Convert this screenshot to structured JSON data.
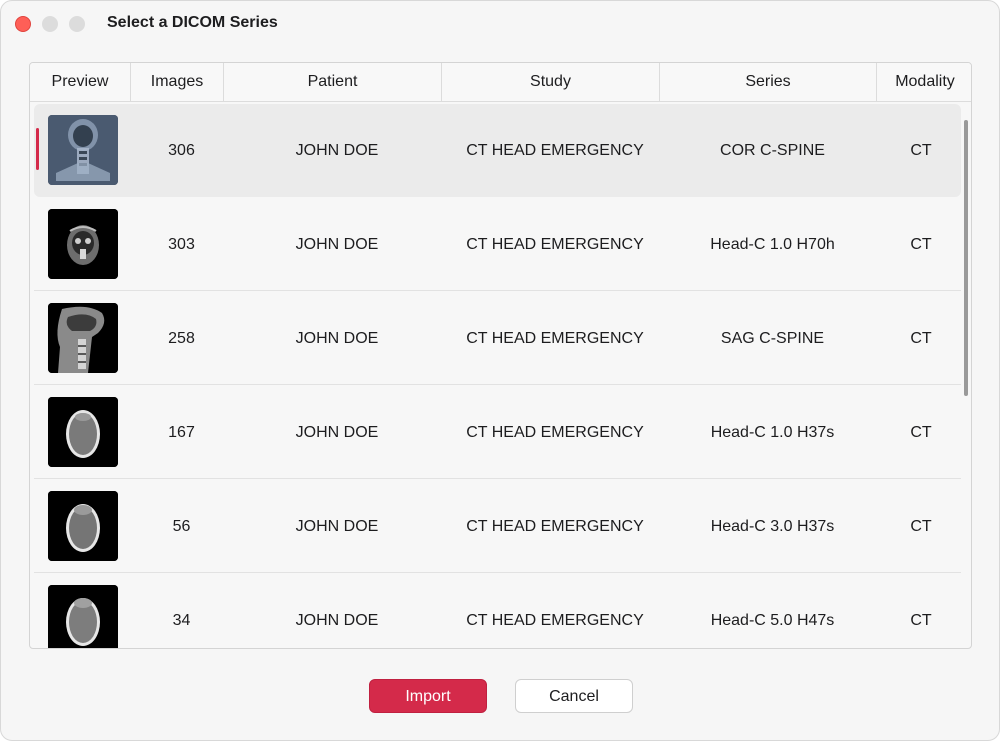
{
  "window": {
    "title": "Select a DICOM Series"
  },
  "table": {
    "columns": [
      "Preview",
      "Images",
      "Patient",
      "Study",
      "Series",
      "Modality"
    ],
    "rows": [
      {
        "images": "306",
        "patient": "JOHN DOE",
        "study": "CT  HEAD EMERGENCY",
        "series": "COR C-SPINE",
        "modality": "CT",
        "preview": "coronal-cspine-thumbnail",
        "selected": true
      },
      {
        "images": "303",
        "patient": "JOHN DOE",
        "study": "CT  HEAD EMERGENCY",
        "series": "Head-C  1.0  H70h",
        "modality": "CT",
        "preview": "axial-face-thumbnail",
        "selected": false
      },
      {
        "images": "258",
        "patient": "JOHN DOE",
        "study": "CT  HEAD EMERGENCY",
        "series": "SAG C-SPINE",
        "modality": "CT",
        "preview": "sagittal-cspine-thumbnail",
        "selected": false
      },
      {
        "images": "167",
        "patient": "JOHN DOE",
        "study": "CT  HEAD EMERGENCY",
        "series": "Head-C  1.0  H37s",
        "modality": "CT",
        "preview": "axial-head-thumbnail",
        "selected": false
      },
      {
        "images": "56",
        "patient": "JOHN DOE",
        "study": "CT  HEAD EMERGENCY",
        "series": "Head-C  3.0  H37s",
        "modality": "CT",
        "preview": "axial-head-thumbnail",
        "selected": false
      },
      {
        "images": "34",
        "patient": "JOHN DOE",
        "study": "CT  HEAD EMERGENCY",
        "series": "Head-C  5.0  H47s",
        "modality": "CT",
        "preview": "axial-head-thumbnail",
        "selected": false
      }
    ]
  },
  "buttons": {
    "import_label": "Import",
    "cancel_label": "Cancel"
  },
  "colors": {
    "accent": "#d42a4a",
    "close": "#fe5f57"
  }
}
